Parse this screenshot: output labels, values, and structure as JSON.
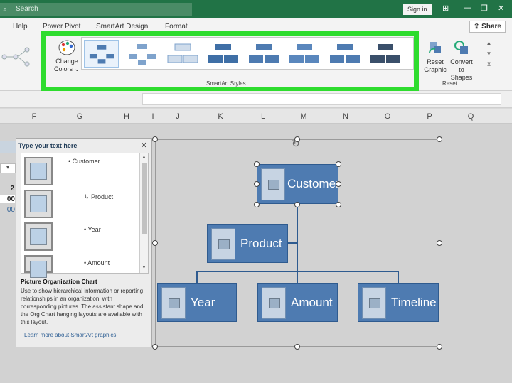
{
  "titlebar": {
    "search_placeholder": "Search",
    "signin_label": "Sign in"
  },
  "tabs": [
    "Help",
    "Power Pivot",
    "SmartArt Design",
    "Format"
  ],
  "share_label": "Share",
  "ribbon": {
    "change_colors_line1": "Change",
    "change_colors_line2": "Colors",
    "styles_group_label": "SmartArt Styles",
    "reset_graphic_line1": "Reset",
    "reset_graphic_line2": "Graphic",
    "convert_line1": "Convert",
    "convert_line2": "to Shapes",
    "reset_group_label": "Reset"
  },
  "columns": [
    "F",
    "G",
    "H",
    "I",
    "J",
    "K",
    "L",
    "M",
    "N",
    "O",
    "P",
    "Q"
  ],
  "left_cells": [
    "2",
    "00",
    "00"
  ],
  "text_pane": {
    "title": "Type your text here",
    "items": [
      "Customer",
      "Product",
      "Year",
      "Amount"
    ],
    "desc_title": "Picture Organization Chart",
    "desc_body": "Use to show hierarchical information or reporting relationships in an organization, with corresponding pictures. The assistant shape and the Org Chart hanging layouts are available with this layout.",
    "link": "Learn more about SmartArt graphics"
  },
  "smartart": {
    "root": "Customer",
    "assistant": "Product",
    "children": [
      "Year",
      "Amount",
      "Timeline"
    ]
  },
  "colors": {
    "excel_green": "#217346",
    "highlight": "#2edc2e",
    "node_fill": "#4e7bb1"
  }
}
